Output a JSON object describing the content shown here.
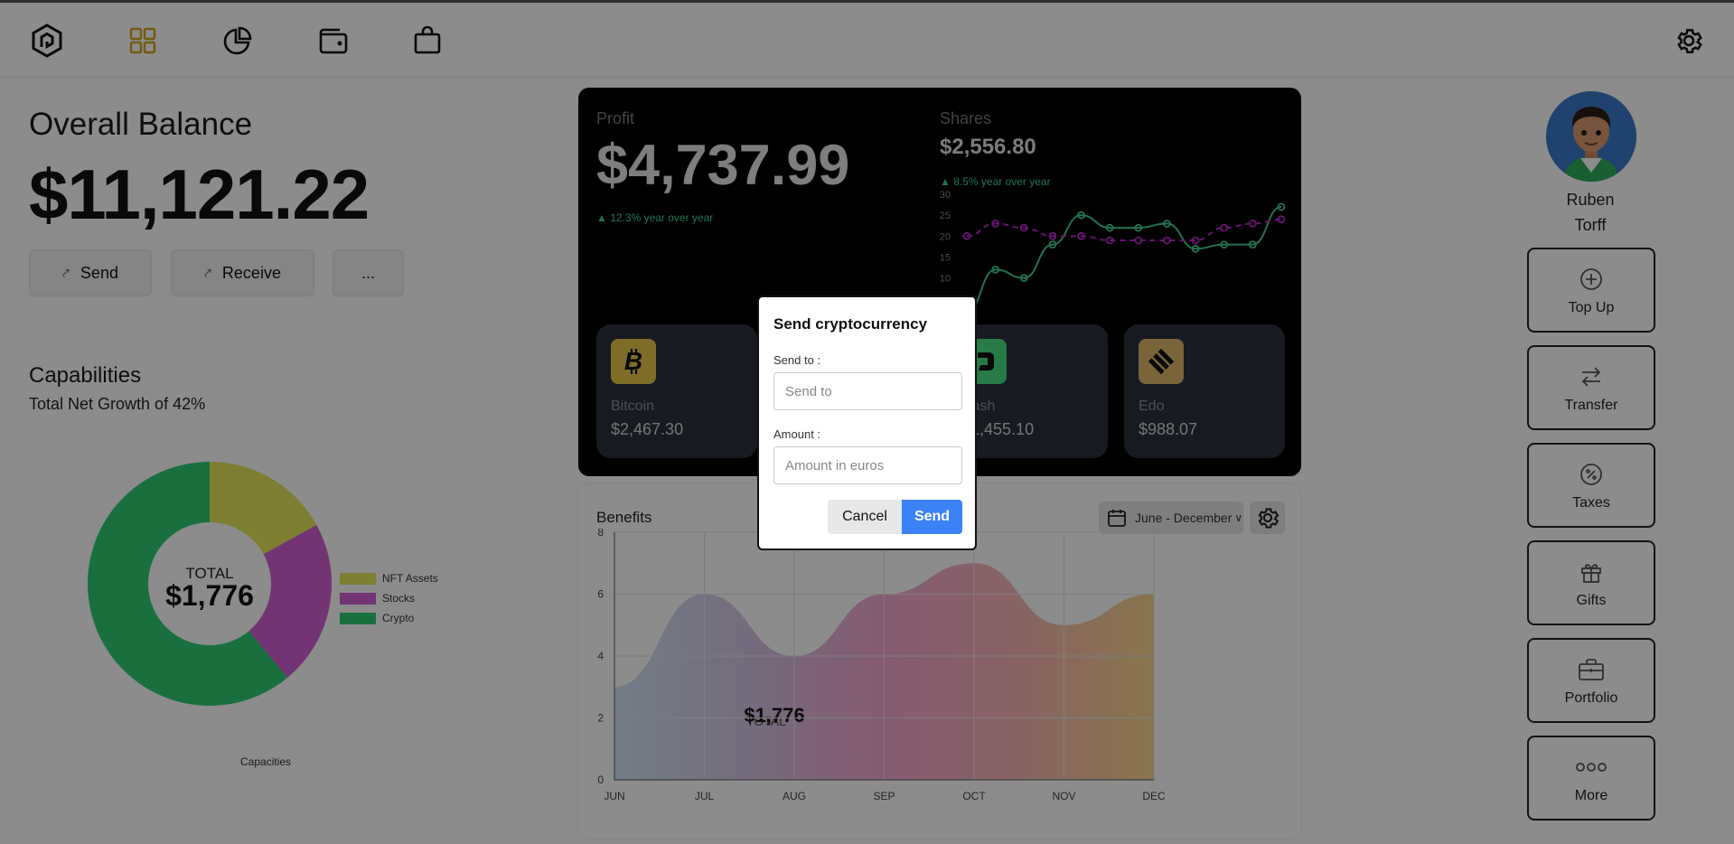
{
  "nav": {
    "icons": [
      "logo-icon",
      "dashboard-grid-icon",
      "pie-chart-icon",
      "wallet-icon",
      "shopping-bag-icon"
    ],
    "settings_icon": "gear-icon",
    "accent": "#d4a017"
  },
  "balance": {
    "title": "Overall Balance",
    "value": "$11,121.22"
  },
  "actions": {
    "send_label": "Send",
    "receive_label": "Receive",
    "more_label": "..."
  },
  "capabilities": {
    "title": "Capabilities",
    "subtitle": "Total Net Growth of 42%",
    "footer": "Capacities",
    "total_label": "TOTAL",
    "total_value": "$1,776"
  },
  "profit": {
    "label": "Profit",
    "value": "$4,737.99",
    "growth": "▲ 12.3% year over year"
  },
  "shares": {
    "label": "Shares",
    "value": "$2,556.80",
    "growth": "▲ 8.5% year over year"
  },
  "coins": [
    {
      "name": "Bitcoin",
      "value": "$2,467.30",
      "color": "#e8c547"
    },
    {
      "name": "Dash",
      "value": "$1,455.10",
      "color": "#4ade80"
    },
    {
      "name": "Edo",
      "value": "$988.07",
      "color": "#e0b46a"
    }
  ],
  "benefits": {
    "title": "Benefits",
    "range": "June - December",
    "overlay_value": "$1,776",
    "overlay_label": "TOTAL"
  },
  "user": {
    "first_name": "Ruben",
    "last_name": "Torff"
  },
  "side_actions": [
    {
      "label": "Top Up",
      "icon": "plus-circle-icon"
    },
    {
      "label": "Transfer",
      "icon": "transfer-arrows-icon"
    },
    {
      "label": "Taxes",
      "icon": "percent-icon"
    },
    {
      "label": "Gifts",
      "icon": "gift-icon"
    },
    {
      "label": "Portfolio",
      "icon": "briefcase-icon"
    },
    {
      "label": "More",
      "icon": "more-dots-icon"
    }
  ],
  "modal": {
    "title": "Send cryptocurrency",
    "send_to_label": "Send to :",
    "send_to_placeholder": "Send to",
    "amount_label": "Amount :",
    "amount_placeholder": "Amount in euros",
    "cancel_label": "Cancel",
    "send_label": "Send"
  },
  "chart_data": [
    {
      "type": "pie",
      "title": "",
      "categories": [
        "NFT Assets",
        "Stocks",
        "Crypto"
      ],
      "values": [
        0.17,
        0.22,
        0.61
      ],
      "colors": [
        "#e3e65a",
        "#cf5fd3",
        "#2ecc71"
      ],
      "legend": "right"
    },
    {
      "type": "line",
      "title": "",
      "x": [
        "1",
        "2",
        "3",
        "4",
        "5",
        "6",
        "7",
        "8",
        "9",
        "10",
        "11",
        "12"
      ],
      "yticks": [
        5,
        10,
        15,
        20,
        25,
        30
      ],
      "ylim": [
        0,
        30
      ],
      "series": [
        {
          "name": "",
          "values": [
            2,
            12,
            10,
            18,
            25,
            22,
            22,
            23,
            17,
            18,
            18,
            27
          ],
          "color": "#3ecf8e",
          "dash": false
        },
        {
          "name": "",
          "values": [
            20,
            23,
            22,
            20,
            20,
            19,
            19,
            19,
            19,
            22,
            23,
            24
          ],
          "color": "#c026d3",
          "dash": true
        }
      ]
    },
    {
      "type": "area",
      "title": "",
      "categories": [
        "JUN",
        "JUL",
        "AUG",
        "SEP",
        "OCT",
        "NOV",
        "DEC"
      ],
      "values": [
        3,
        6,
        4,
        6,
        7,
        5,
        6
      ],
      "ylim": [
        0,
        8
      ],
      "yticks": [
        0,
        2,
        4,
        6,
        8
      ],
      "grid": true
    }
  ]
}
